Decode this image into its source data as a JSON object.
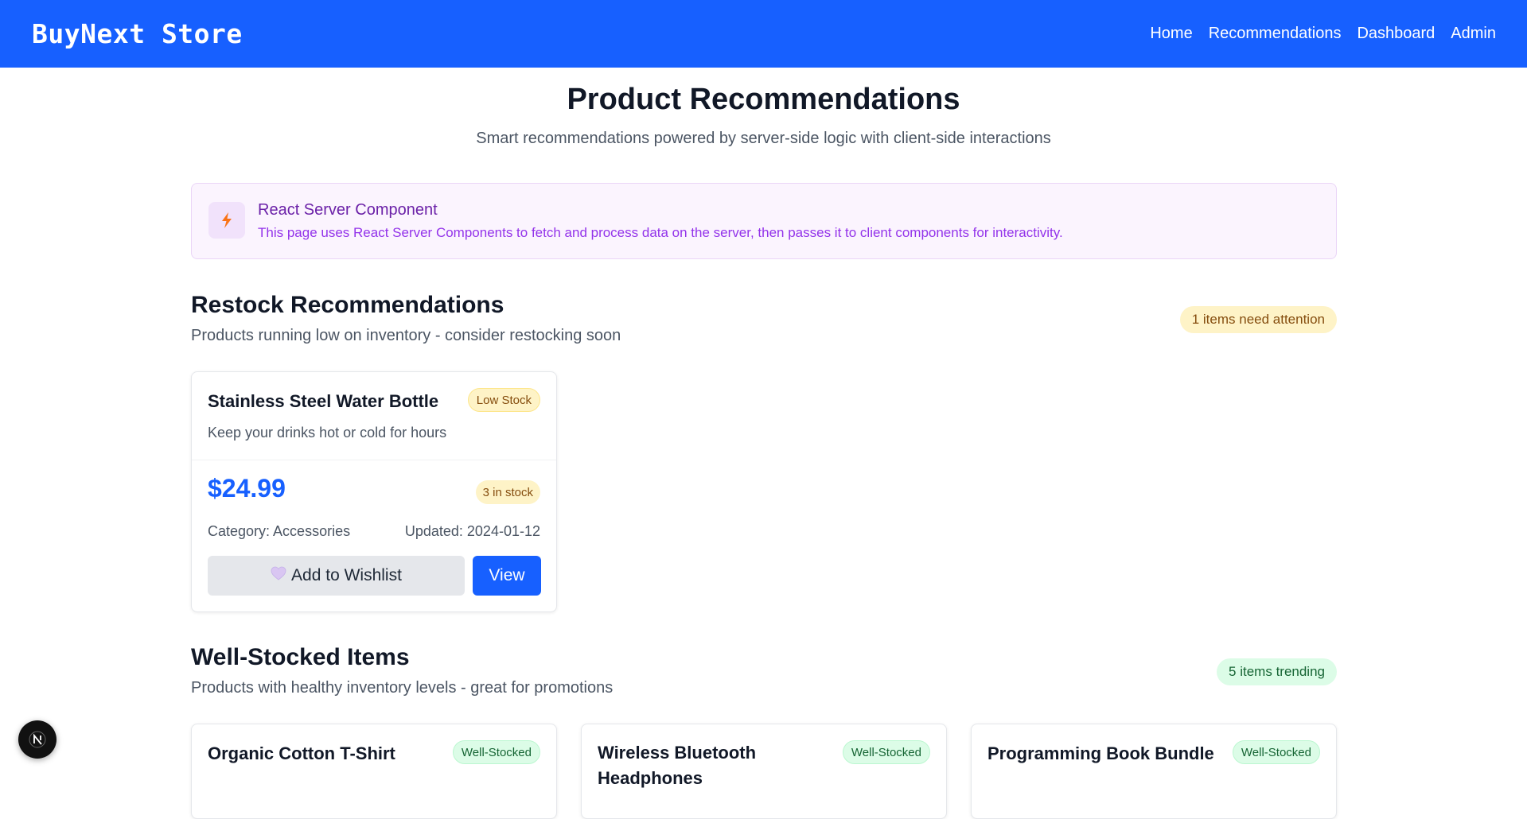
{
  "header": {
    "brand": "BuyNext Store",
    "nav": [
      "Home",
      "Recommendations",
      "Dashboard",
      "Admin"
    ]
  },
  "page": {
    "title": "Product Recommendations",
    "subtitle": "Smart recommendations powered by server-side logic with client-side interactions"
  },
  "banner": {
    "icon": "lightning-icon",
    "title": "React Server Component",
    "text": "This page uses React Server Components to fetch and process data on the server, then passes it to client components for interactivity."
  },
  "restock": {
    "title": "Restock Recommendations",
    "subtitle": "Products running low on inventory - consider restocking soon",
    "pill": "1 items need attention",
    "products": [
      {
        "name": "Stainless Steel Water Bottle",
        "badge": "Low Stock",
        "description": "Keep your drinks hot or cold for hours",
        "price": "$24.99",
        "stock": "3 in stock",
        "category": "Category: Accessories",
        "updated": "Updated: 2024-01-12",
        "wishlist_label": "Add to Wishlist",
        "view_label": "View"
      }
    ]
  },
  "wellstocked": {
    "title": "Well-Stocked Items",
    "subtitle": "Products with healthy inventory levels - great for promotions",
    "pill": "5 items trending",
    "products": [
      {
        "name": "Organic Cotton T-Shirt",
        "badge": "Well-Stocked"
      },
      {
        "name": "Wireless Bluetooth Headphones",
        "badge": "Well-Stocked"
      },
      {
        "name": "Programming Book Bundle",
        "badge": "Well-Stocked"
      }
    ]
  },
  "colors": {
    "primary": "#1760ff",
    "warning_bg": "#fef3c7",
    "success_bg": "#dcfce7",
    "banner_bg": "#fbf4fe"
  }
}
